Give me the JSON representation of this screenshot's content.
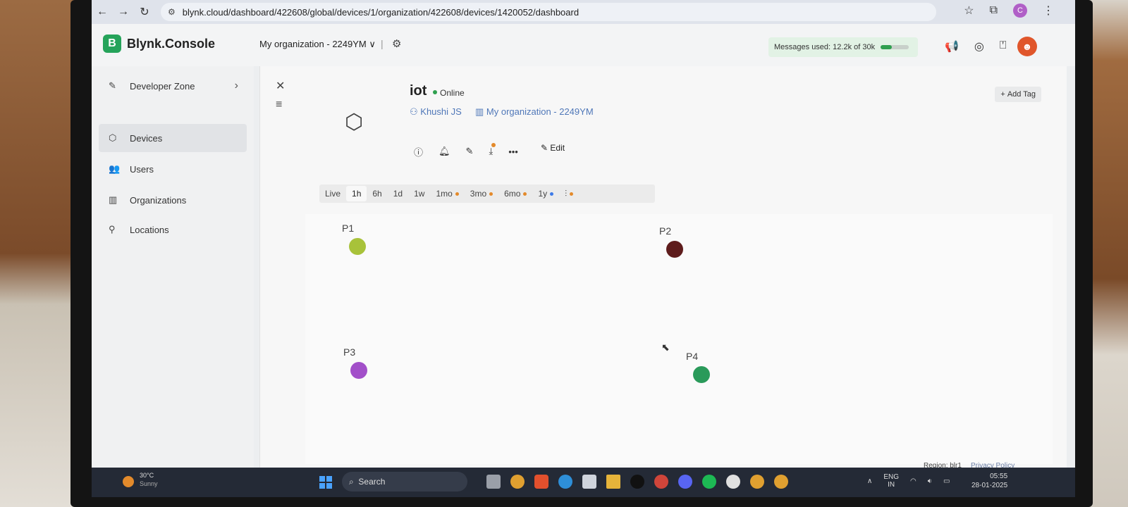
{
  "browser": {
    "url": "blynk.cloud/dashboard/422608/global/devices/1/organization/422608/devices/1420052/dashboard",
    "profile_initial": "C"
  },
  "header": {
    "logo_letter": "B",
    "app_name": "Blynk.Console",
    "org_name": "My organization - 2249YM",
    "messages_used": "Messages used: 12.2k of 30k",
    "messages_fraction": 0.41,
    "brand_color": "#25a35a"
  },
  "sidebar": {
    "items": [
      {
        "label": "Developer Zone",
        "icon": "wrench-icon"
      },
      {
        "label": "Devices",
        "icon": "cube-icon"
      },
      {
        "label": "Users",
        "icon": "users-icon"
      },
      {
        "label": "Organizations",
        "icon": "building-icon"
      },
      {
        "label": "Locations",
        "icon": "pin-icon"
      }
    ]
  },
  "device": {
    "name": "iot",
    "status": "Online",
    "owner": "Khushi JS",
    "organization": "My organization - 2249YM",
    "add_tag": "Add Tag",
    "edit": "Edit"
  },
  "time_ranges": [
    {
      "label": "Live"
    },
    {
      "label": "1h",
      "selected": true
    },
    {
      "label": "6h"
    },
    {
      "label": "1d"
    },
    {
      "label": "1w"
    },
    {
      "label": "1mo",
      "dot": "orange"
    },
    {
      "label": "3mo",
      "dot": "orange"
    },
    {
      "label": "6mo",
      "dot": "orange"
    },
    {
      "label": "1y",
      "dot": "blue"
    }
  ],
  "widgets": [
    {
      "label": "P1",
      "color": "#a8c23a"
    },
    {
      "label": "P2",
      "color": "#5e1c1c"
    },
    {
      "label": "P3",
      "color": "#a24fc9"
    },
    {
      "label": "P4",
      "color": "#2a9a5a"
    }
  ],
  "footer": {
    "region": "Region: blr1",
    "privacy": "Privacy Policy"
  },
  "taskbar": {
    "temperature": "30°C",
    "weather": "Sunny",
    "search": "Search",
    "language": "ENG",
    "language_sub": "IN",
    "time": "05:55",
    "date": "28-01-2025"
  }
}
